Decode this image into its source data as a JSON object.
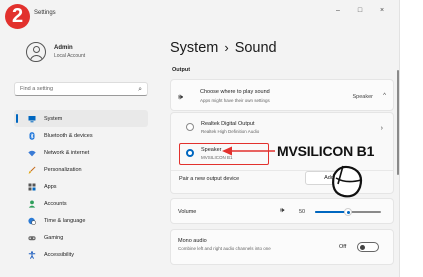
{
  "window": {
    "title": "Settings",
    "controls": {
      "minimize": "–",
      "maximize": "□",
      "close": "×"
    }
  },
  "step_number": "2",
  "profile": {
    "name": "Admin",
    "subtitle": "Local Account"
  },
  "search": {
    "placeholder": "Find a setting"
  },
  "sidebar": {
    "items": [
      {
        "label": "System",
        "icon": "monitor-icon",
        "active": true
      },
      {
        "label": "Bluetooth & devices",
        "icon": "bluetooth-icon"
      },
      {
        "label": "Network & internet",
        "icon": "wifi-icon"
      },
      {
        "label": "Personalization",
        "icon": "brush-icon"
      },
      {
        "label": "Apps",
        "icon": "apps-icon"
      },
      {
        "label": "Accounts",
        "icon": "person-icon"
      },
      {
        "label": "Time & language",
        "icon": "globe-clock-icon"
      },
      {
        "label": "Gaming",
        "icon": "controller-icon"
      },
      {
        "label": "Accessibility",
        "icon": "accessibility-icon"
      }
    ]
  },
  "breadcrumb": {
    "parent": "System",
    "separator": "›",
    "current": "Sound"
  },
  "output": {
    "section_label": "Output",
    "choose": {
      "title": "Choose where to play sound",
      "subtitle": "Apps might have their own settings",
      "value": "Speaker",
      "chevron": "^"
    },
    "devices": [
      {
        "name": "Realtek Digital Output",
        "subtitle": "Realtek High Definition Audio",
        "selected": false,
        "chevron": "›"
      },
      {
        "name": "Speaker",
        "subtitle": "MVSILICON B1",
        "selected": true
      }
    ],
    "pair": {
      "label": "Pair a new output device",
      "button": "Add"
    }
  },
  "volume": {
    "label": "Volume",
    "value": "50",
    "level": 0.5
  },
  "mono_audio": {
    "title": "Mono audio",
    "subtitle": "Combine left and right audio channels into one",
    "state": "Off",
    "on": false
  },
  "annotation": {
    "text": "MVSILICON B1"
  },
  "colors": {
    "accent": "#0067c0",
    "highlight": "#e2312d",
    "background": "#f3f3f3"
  }
}
